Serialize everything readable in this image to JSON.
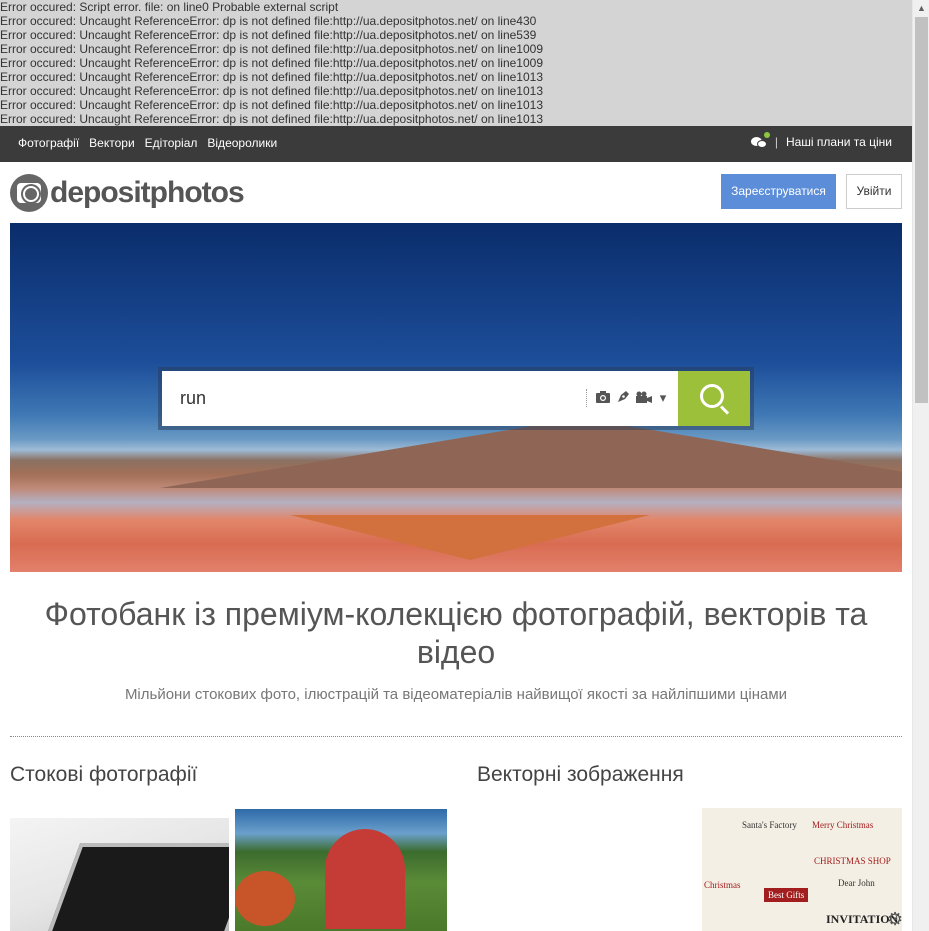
{
  "errors": [
    "Error occured: Script error. file: on line0 Probable external script",
    "Error occured: Uncaught ReferenceError: dp is not defined file:http://ua.depositphotos.net/ on line430",
    "Error occured: Uncaught ReferenceError: dp is not defined file:http://ua.depositphotos.net/ on line539",
    "Error occured: Uncaught ReferenceError: dp is not defined file:http://ua.depositphotos.net/ on line1009",
    "Error occured: Uncaught ReferenceError: dp is not defined file:http://ua.depositphotos.net/ on line1009",
    "Error occured: Uncaught ReferenceError: dp is not defined file:http://ua.depositphotos.net/ on line1013",
    "Error occured: Uncaught ReferenceError: dp is not defined file:http://ua.depositphotos.net/ on line1013",
    "Error occured: Uncaught ReferenceError: dp is not defined file:http://ua.depositphotos.net/ on line1013",
    "Error occured: Uncaught ReferenceError: dp is not defined file:http://ua.depositphotos.net/ on line1013"
  ],
  "topnav": {
    "links": [
      "Фотографії",
      "Вектори",
      "Едіторіал",
      "Відеоролики"
    ],
    "separator": "|",
    "plans": "Наші плани та ціни"
  },
  "header": {
    "logo_text": "depositphotos",
    "register": "Зареєструватися",
    "login": "Увійти"
  },
  "search": {
    "value": "run",
    "icons": [
      "camera-icon",
      "pen-icon",
      "video-camera-icon",
      "caret-down-icon"
    ]
  },
  "main": {
    "title": "Фотобанк із преміум-колекцією фотографій, векторів та відео",
    "subtitle": "Мільйони стокових фото, ілюстрацій та відеоматеріалів найвищої якості за найліпшими цінами",
    "section_stock": "Стокові фотографії",
    "section_vector": "Векторні зображення"
  },
  "vector_thumb": {
    "lines": [
      "Santa's Factory",
      "Merry Christmas",
      "CHRISTMAS SHOP",
      "Best Gifts",
      "Dear John",
      "INVITATION",
      "Christmas"
    ]
  },
  "colors": {
    "nav_bg": "#3b3b3b",
    "register_bg": "#5b8dd9",
    "search_btn": "#9dc03a"
  }
}
